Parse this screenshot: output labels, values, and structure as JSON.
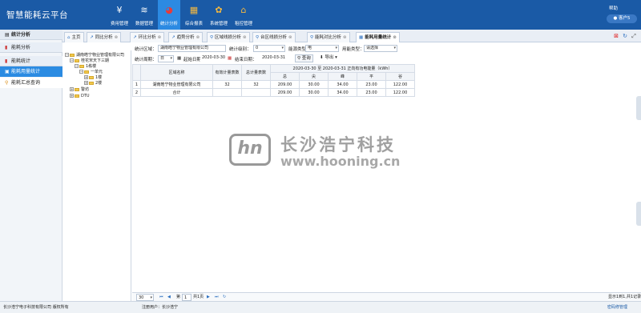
{
  "header": {
    "app_title": "智慧能耗云平台",
    "nav": [
      {
        "label": "费用管理",
        "icon": "yen-icon",
        "glyph": "¥"
      },
      {
        "label": "数据管理",
        "icon": "database-icon",
        "glyph": "≋"
      },
      {
        "label": "统计分析",
        "icon": "pie-chart-icon",
        "glyph": "◕"
      },
      {
        "label": "综合报表",
        "icon": "table-icon",
        "glyph": "▦"
      },
      {
        "label": "系统管理",
        "icon": "gear-icon",
        "glyph": "✿"
      },
      {
        "label": "租控管理",
        "icon": "house-icon",
        "glyph": "⌂"
      }
    ],
    "help": "帮助",
    "user": "客户5"
  },
  "sidebar": {
    "title": "统计分析",
    "group1": "能耗分析",
    "group2": "能耗统计",
    "items": [
      "能耗用量统计",
      "能耗汇总查询"
    ]
  },
  "tabs": [
    "主页",
    "同比分析",
    "环比分析",
    "趋势分析",
    "区域线损分析",
    "台区线损分析",
    "能耗对比分析",
    "能耗用量统计"
  ],
  "filters": {
    "area_label": "统计区域：",
    "area_value": "湖南皓宁物业管理有限公司",
    "level_label": "统计级别：",
    "level_value": "0",
    "energy_label": "能源类型：",
    "energy_value": "电",
    "usage_label": "用能类型：",
    "usage_value": "请选择",
    "period_label": "统计周期：",
    "period_value": "日",
    "start_label": "起始日期：",
    "start_value": "2020-03-30",
    "end_label": "结束日期：",
    "end_value": "2020-03-31",
    "query_btn": "查询",
    "export_btn": "导出"
  },
  "tree": [
    "湖南皓宁物业管理有限公司",
    "桂花宋天下三期",
    "1栋楼",
    "一单元",
    "1楼",
    "2楼",
    "警坊",
    "DTU"
  ],
  "table": {
    "headers": {
      "area": "区域名称",
      "valid_meters": "有效计量表数",
      "total_meters": "总计量表数",
      "range": "2020-03-30 至 2020-03-31 正向有功电能量（kWh）",
      "sub": [
        "总",
        "尖",
        "峰",
        "平",
        "谷"
      ]
    },
    "rows": [
      {
        "idx": "1",
        "area": "湖南皓宁物业管理有限公司",
        "valid": "32",
        "total": "32",
        "v": [
          "209.00",
          "30.00",
          "34.00",
          "23.00",
          "122.00"
        ]
      },
      {
        "idx": "2",
        "area": "合计",
        "valid": "",
        "total": "",
        "v": [
          "209.00",
          "30.00",
          "34.00",
          "23.00",
          "122.00"
        ]
      }
    ]
  },
  "watermark": {
    "cn": "长沙浩宁科技",
    "url": "www.hooning.cn",
    "logo": "hn"
  },
  "pager": {
    "page_size": "30",
    "page_label": "第",
    "page_value": "1",
    "total_pages": "共1页",
    "summary": "显示1到1,共1记录"
  },
  "footer": {
    "company": "长沙浩宁电子科技有限公司 版权所有",
    "user": "注册用户：长沙浩宁",
    "link": "密码修管理"
  }
}
